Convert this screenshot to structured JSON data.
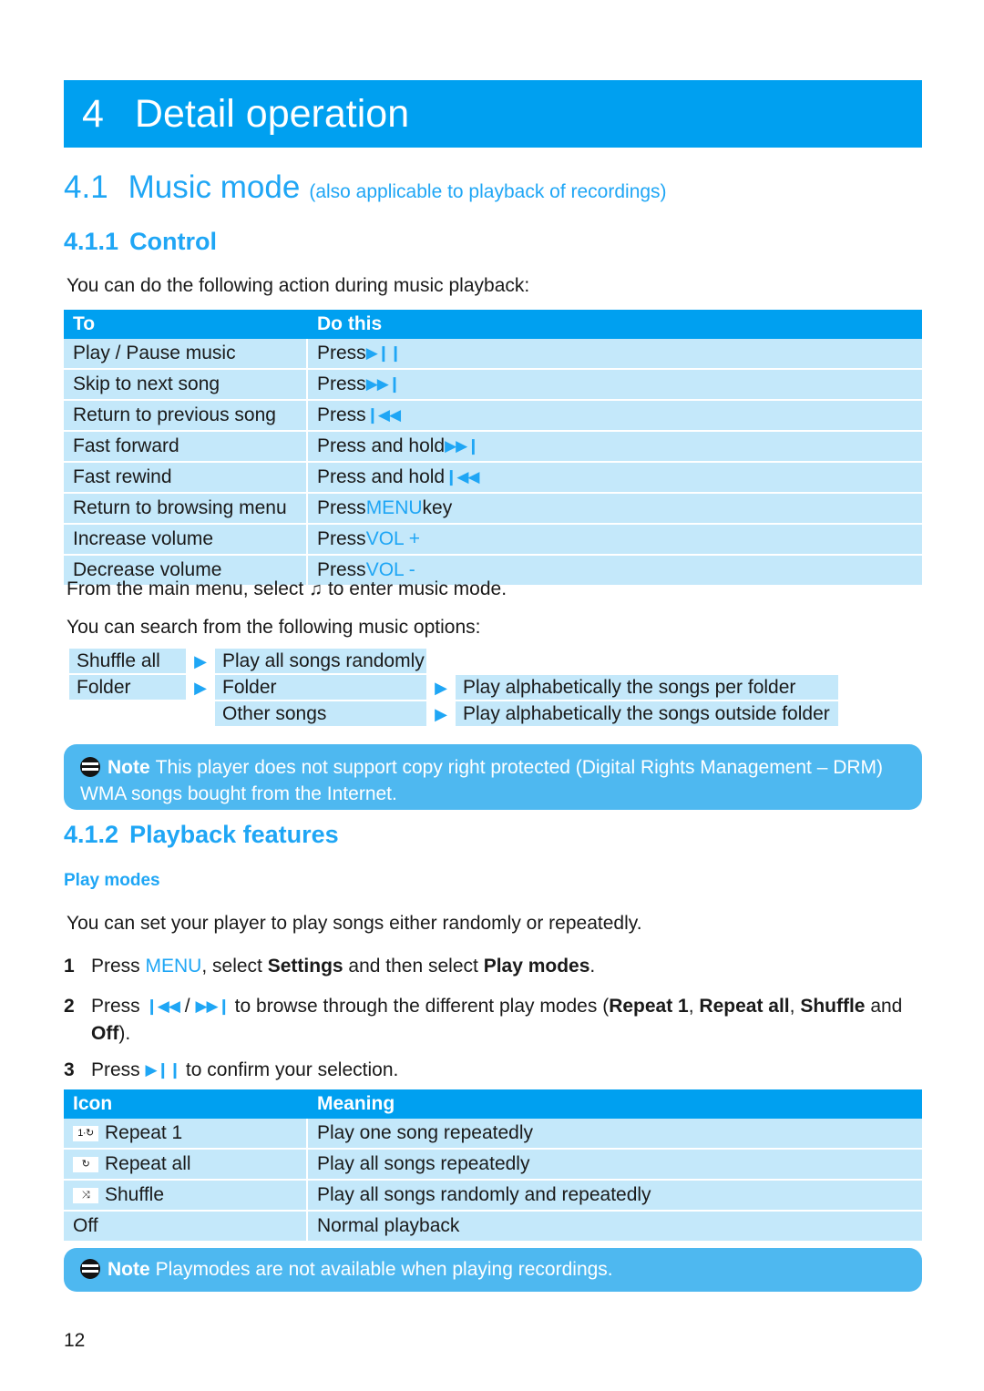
{
  "document": {
    "page_number": "12",
    "accent_blue": "#00A0F0",
    "light_blue": "#C4E8FA",
    "note_blue": "#4EB8F0",
    "heading_blue": "#1FA6F5"
  },
  "chapter": {
    "number": "4",
    "title": "Detail operation"
  },
  "section": {
    "number": "4.1",
    "title": "Music mode",
    "subtitle": "(also applicable to playback of recordings)"
  },
  "subsection_control": {
    "number": "4.1.1",
    "title": "Control",
    "intro": "You can do the following action during music playback:"
  },
  "control_table": {
    "headers": [
      "To",
      "Do this"
    ],
    "rows": [
      {
        "to": "Play / Pause music",
        "prefix": "Press",
        "glyph": "▶❙❙",
        "glyph_name": "play-pause-icon",
        "keyword": ""
      },
      {
        "to": "Skip to next song",
        "prefix": "Press",
        "glyph": "▶▶❙",
        "glyph_name": "next-track-icon",
        "keyword": ""
      },
      {
        "to": "Return to previous song",
        "prefix": "Press",
        "glyph": "❙◀◀",
        "glyph_name": "previous-track-icon",
        "keyword": ""
      },
      {
        "to": "Fast forward",
        "prefix": "Press and hold",
        "glyph": "▶▶❙",
        "glyph_name": "next-track-icon",
        "keyword": ""
      },
      {
        "to": "Fast rewind",
        "prefix": "Press and hold",
        "glyph": "❙◀◀",
        "glyph_name": "previous-track-icon",
        "keyword": ""
      },
      {
        "to": "Return to browsing menu",
        "prefix": "Press",
        "glyph": "",
        "glyph_name": "",
        "keyword": "MENU",
        "suffix": "key"
      },
      {
        "to": "Increase volume",
        "prefix": "Press",
        "glyph": "",
        "glyph_name": "",
        "keyword": "VOL +",
        "suffix": ""
      },
      {
        "to": "Decrease volume",
        "prefix": "Press",
        "glyph": "",
        "glyph_name": "",
        "keyword": "VOL -",
        "suffix": ""
      }
    ]
  },
  "music_mode_lines": {
    "enter_before": "From the main menu, select",
    "enter_glyph": "♫",
    "enter_after": "to enter music mode.",
    "search_options": "You can search from the following music options:"
  },
  "options_diagram": {
    "arrow_glyph": "▶",
    "rows": [
      {
        "col1": "Shuffle all",
        "col2": "Play all songs randomly",
        "col3": "",
        "arrow1": true,
        "arrow2": false
      },
      {
        "col1": "Folder",
        "col2": "Folder",
        "col3": "Play alphabetically the songs per folder",
        "arrow1": true,
        "arrow2": true
      },
      {
        "col1": "",
        "col2": "Other songs",
        "col3": "Play alphabetically the songs outside folder",
        "arrow1": false,
        "arrow2": true
      }
    ]
  },
  "note_drm": {
    "label": "Note",
    "text": "This player does not support copy right protected (Digital Rights Management – DRM) WMA songs bought from the Internet."
  },
  "subsection_playback": {
    "number": "4.1.2",
    "title": "Playback features",
    "sub_heading": "Play modes",
    "intro": "You can set your player to play songs either randomly or repeatedly."
  },
  "steps": [
    {
      "num": "1",
      "parts": [
        {
          "t": "Press ",
          "style": "plain"
        },
        {
          "t": "MENU",
          "style": "blue"
        },
        {
          "t": ", select ",
          "style": "plain"
        },
        {
          "t": "Settings",
          "style": "bold"
        },
        {
          "t": " and then select ",
          "style": "plain"
        },
        {
          "t": "Play modes",
          "style": "bold"
        },
        {
          "t": ".",
          "style": "plain"
        }
      ]
    },
    {
      "num": "2",
      "parts": [
        {
          "t": "Press ",
          "style": "plain"
        },
        {
          "t": "❙◀◀",
          "style": "glyph"
        },
        {
          "t": " / ",
          "style": "plain"
        },
        {
          "t": "▶▶❙",
          "style": "glyph"
        },
        {
          "t": " to browse through the different play modes (",
          "style": "plain"
        },
        {
          "t": "Repeat 1",
          "style": "bold"
        },
        {
          "t": ", ",
          "style": "plain"
        },
        {
          "t": "Repeat all",
          "style": "bold"
        },
        {
          "t": ", ",
          "style": "plain"
        },
        {
          "t": "Shuffle",
          "style": "bold"
        },
        {
          "t": " and ",
          "style": "plain"
        },
        {
          "t": "Off",
          "style": "bold"
        },
        {
          "t": ").",
          "style": "plain"
        }
      ]
    },
    {
      "num": "3",
      "parts": [
        {
          "t": "Press ",
          "style": "plain"
        },
        {
          "t": "▶❙❙",
          "style": "glyph"
        },
        {
          "t": " to confirm your selection.",
          "style": "plain"
        }
      ]
    }
  ],
  "icon_table": {
    "headers": [
      "Icon",
      "Meaning"
    ],
    "rows": [
      {
        "chip": "1·↻",
        "chip_name": "repeat-one-icon",
        "label": "Repeat 1",
        "meaning": "Play one song repeatedly"
      },
      {
        "chip": "↻",
        "chip_name": "repeat-all-icon",
        "label": "Repeat all",
        "meaning": "Play all songs repeatedly"
      },
      {
        "chip": "⤨",
        "chip_name": "shuffle-icon",
        "label": "Shuffle",
        "meaning": "Play all songs randomly and repeatedly"
      },
      {
        "chip": "",
        "chip_name": "",
        "label": "Off",
        "meaning": "Normal playback"
      }
    ]
  },
  "note_playmodes": {
    "label": "Note",
    "text": "Playmodes are not available when playing recordings."
  }
}
